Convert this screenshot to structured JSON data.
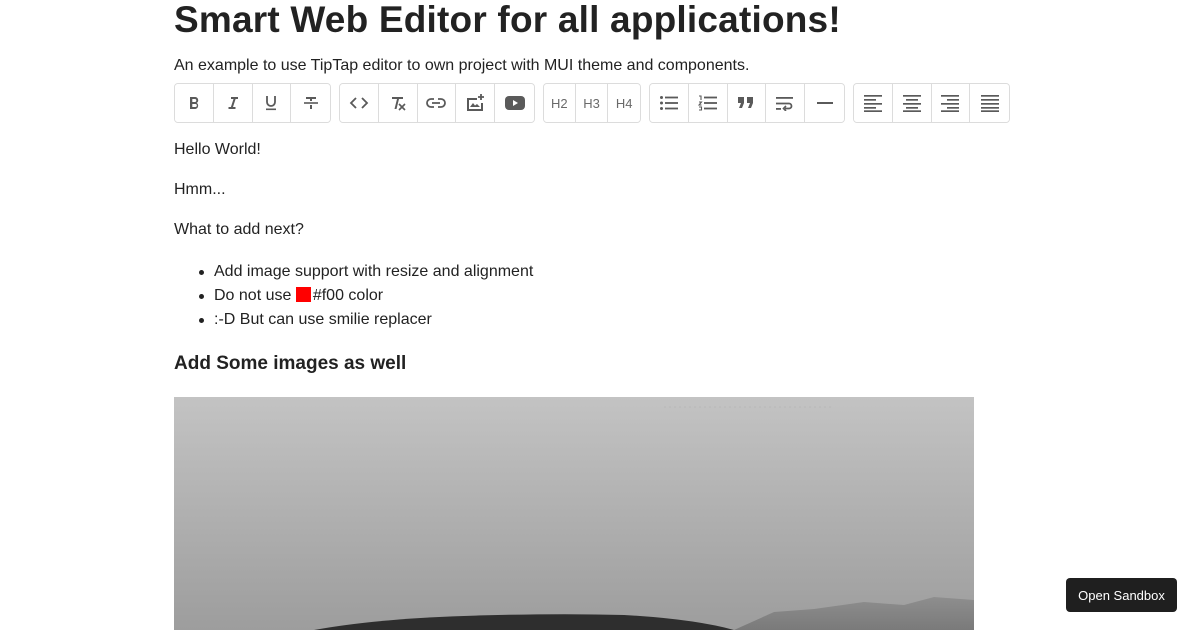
{
  "page": {
    "title": "Smart Web Editor for all applications!",
    "subtitle": "An example to use TipTap editor to own project with MUI theme and components."
  },
  "toolbar": {
    "heading_labels": [
      "H2",
      "H3",
      "H4"
    ],
    "icons": [
      "bold-icon",
      "italic-icon",
      "underline-icon",
      "strikethrough-icon",
      "code-icon",
      "clear-format-icon",
      "link-icon",
      "add-image-icon",
      "youtube-icon",
      "bullet-list-icon",
      "ordered-list-icon",
      "blockquote-icon",
      "hard-break-icon",
      "horizontal-rule-icon",
      "align-left-icon",
      "align-center-icon",
      "align-right-icon",
      "align-justify-icon"
    ]
  },
  "editor": {
    "paragraphs": [
      "Hello World!",
      "Hmm...",
      "What to add next?"
    ],
    "bullets": {
      "item1": "Add image support with resize and alignment",
      "item2_prefix": "Do not use ",
      "item2_suffix": "#f00 color",
      "item3": ":-D But can use smilie replacer"
    },
    "swatch_color": "#ff0000",
    "heading": "Add Some images as well"
  },
  "sandbox_button": {
    "label": "Open Sandbox"
  }
}
